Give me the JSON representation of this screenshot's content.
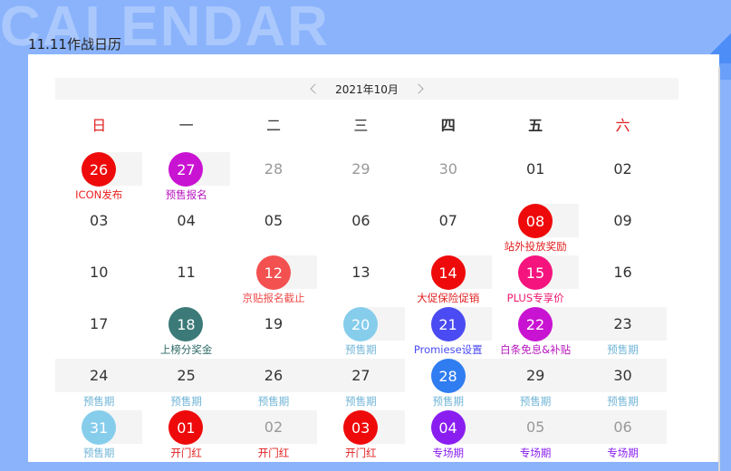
{
  "background_word": "CALENDAR",
  "title": "11.11作战日历",
  "month_label": "2021年10月",
  "weekdays": [
    "日",
    "一",
    "二",
    "三",
    "四",
    "五",
    "六"
  ],
  "days": [
    {
      "day": "26",
      "circle": "#ee0a0a",
      "label": "ICON发布",
      "label_color": "#ee2020",
      "shade": "half"
    },
    {
      "day": "27",
      "circle": "#c913d2",
      "label": "预售报名",
      "label_color": "#b716be",
      "shade": "half"
    },
    {
      "day": "28",
      "other": true
    },
    {
      "day": "29",
      "other": true
    },
    {
      "day": "30",
      "other": true
    },
    {
      "day": "01"
    },
    {
      "day": "02"
    },
    {
      "day": "03"
    },
    {
      "day": "04"
    },
    {
      "day": "05"
    },
    {
      "day": "06"
    },
    {
      "day": "07"
    },
    {
      "day": "08",
      "circle": "#ee0a0a",
      "label": "站外投放奖励",
      "label_color": "#e02020",
      "shade": "half"
    },
    {
      "day": "09"
    },
    {
      "day": "10"
    },
    {
      "day": "11"
    },
    {
      "day": "12",
      "circle": "#f35050",
      "label": "京贴报名截止",
      "label_color": "#f04a4a",
      "shade": "half"
    },
    {
      "day": "13"
    },
    {
      "day": "14",
      "circle": "#ee0a0a",
      "label": "大促保险促销",
      "label_color": "#e02020",
      "shade": "half"
    },
    {
      "day": "15",
      "circle": "#f5137e",
      "label": "PLUS专享价",
      "label_color": "#f0186f",
      "shade": "half"
    },
    {
      "day": "16"
    },
    {
      "day": "17"
    },
    {
      "day": "18",
      "circle": "#3b7a78",
      "label": "上榜分奖金",
      "label_color": "#2e6a68"
    },
    {
      "day": "19"
    },
    {
      "day": "20",
      "circle": "#86cdec",
      "label": "预售期",
      "label_color": "#6fb4d6",
      "shade": "half"
    },
    {
      "day": "21",
      "circle": "#4a4bf2",
      "label": "Promiese设置",
      "label_color": "#4a4bf2",
      "shade": "half"
    },
    {
      "day": "22",
      "circle": "#c913d2",
      "label": "白条免息&补贴",
      "label_color": "#b716be",
      "shade": "half"
    },
    {
      "day": "23",
      "label": "预售期",
      "label_color": "#6fb4d6",
      "shade": "full"
    },
    {
      "day": "24",
      "label": "预售期",
      "label_color": "#6fb4d6",
      "shade": "full"
    },
    {
      "day": "25",
      "label": "预售期",
      "label_color": "#6fb4d6",
      "shade": "full"
    },
    {
      "day": "26",
      "label": "预售期",
      "label_color": "#6fb4d6",
      "shade": "full"
    },
    {
      "day": "27",
      "label": "预售期",
      "label_color": "#6fb4d6",
      "shade": "full"
    },
    {
      "day": "28",
      "circle": "#2f7df0",
      "label": "预售期",
      "label_color": "#6fb4d6",
      "shade": "half"
    },
    {
      "day": "29",
      "label": "预售期",
      "label_color": "#6fb4d6",
      "shade": "full"
    },
    {
      "day": "30",
      "label": "预售期",
      "label_color": "#6fb4d6",
      "shade": "full"
    },
    {
      "day": "31",
      "circle": "#86cdec",
      "label": "预售期",
      "label_color": "#6fb4d6",
      "shade": "half"
    },
    {
      "day": "01",
      "circle": "#ee0a0a",
      "label": "开门红",
      "label_color": "#e02020",
      "shade": "half"
    },
    {
      "day": "02",
      "other": true,
      "label": "开门红",
      "label_color": "#e02020",
      "shade": "full"
    },
    {
      "day": "03",
      "circle": "#ee0a0a",
      "label": "开门红",
      "label_color": "#e02020",
      "shade": "half"
    },
    {
      "day": "04",
      "circle": "#8a1ef0",
      "label": "专场期",
      "label_color": "#8a1ef0",
      "shade": "half"
    },
    {
      "day": "05",
      "other": true,
      "label": "专场期",
      "label_color": "#8a1ef0",
      "shade": "full"
    },
    {
      "day": "06",
      "other": true,
      "label": "专场期",
      "label_color": "#8a1ef0",
      "shade": "full"
    }
  ]
}
